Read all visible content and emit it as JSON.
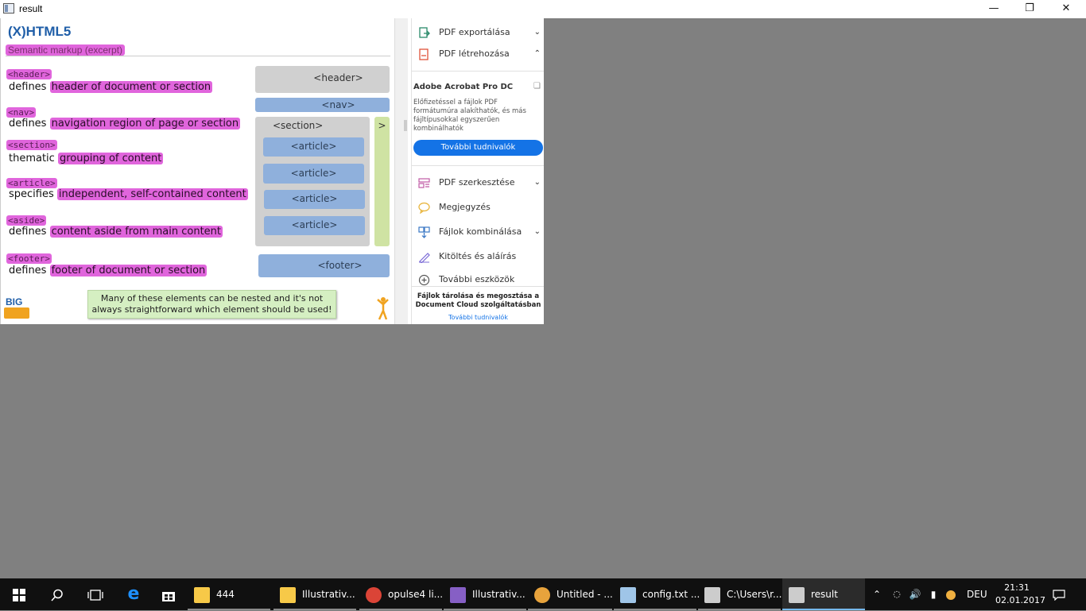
{
  "window": {
    "title": "result",
    "minimize": "—",
    "maximize": "❐",
    "close": "✕"
  },
  "slide": {
    "title": "(X)HTML5",
    "subtitle": "Semantic markup (excerpt)",
    "items": [
      {
        "tag": "<header>",
        "prefix": "defines",
        "highlight": "header of document or section"
      },
      {
        "tag": "<nav>",
        "prefix": "defines",
        "highlight": "navigation region of page or section"
      },
      {
        "tag": "<section>",
        "prefix": "thematic",
        "highlight": "grouping of content"
      },
      {
        "tag": "<article>",
        "prefix": "specifies",
        "highlight": "independent, self-contained content"
      },
      {
        "tag": "<aside>",
        "prefix": "defines",
        "highlight": "content aside from main content"
      },
      {
        "tag": "<footer>",
        "prefix": "defines",
        "highlight": "footer of document or section"
      }
    ],
    "diagram": {
      "header": "<header>",
      "nav": "<nav>",
      "section": "<section>",
      "articles": [
        "<article>",
        "<article>",
        "<article>",
        "<article>"
      ],
      "aside": ">",
      "footer": "<footer>"
    },
    "note": "Many of these elements can be nested and it's not always straightforward which element should be used!",
    "logo": "BIG"
  },
  "panel": {
    "export_pdf": "PDF exportálása",
    "create_pdf": "PDF létrehozása",
    "acrobat_title": "Adobe Acrobat Pro DC",
    "acrobat_desc": "Előfizetéssel a fájlok PDF formátumúra alakíthatók, és más fájltípusokkal egyszerűen kombinálhatók",
    "acrobat_button": "További tudnivalók",
    "edit_pdf": "PDF szerkesztése",
    "comment": "Megjegyzés",
    "combine": "Fájlok kombinálása",
    "fill_sign": "Kitöltés és aláírás",
    "more_tools": "További eszközök",
    "cloud_text": "Fájlok tárolása és megosztása a Document Cloud szolgáltatásban",
    "cloud_link": "További tudnivalók"
  },
  "taskbar": {
    "apps": [
      {
        "label": "444",
        "color": "#f7c948"
      },
      {
        "label": "Illustrativ...",
        "color": "#f7c948"
      },
      {
        "label": "opulse4 li...",
        "color": "#db4437"
      },
      {
        "label": "Illustrativ...",
        "color": "#865fc5"
      },
      {
        "label": "Untitled - ...",
        "color": "#e8a33c"
      },
      {
        "label": "config.txt ...",
        "color": "#9fc5e8"
      },
      {
        "label": "C:\\Users\\r...",
        "color": "#cccccc"
      },
      {
        "label": "result",
        "color": "#cccccc"
      }
    ],
    "language": "DEU",
    "time": "21:31",
    "date": "02.01.2017"
  }
}
